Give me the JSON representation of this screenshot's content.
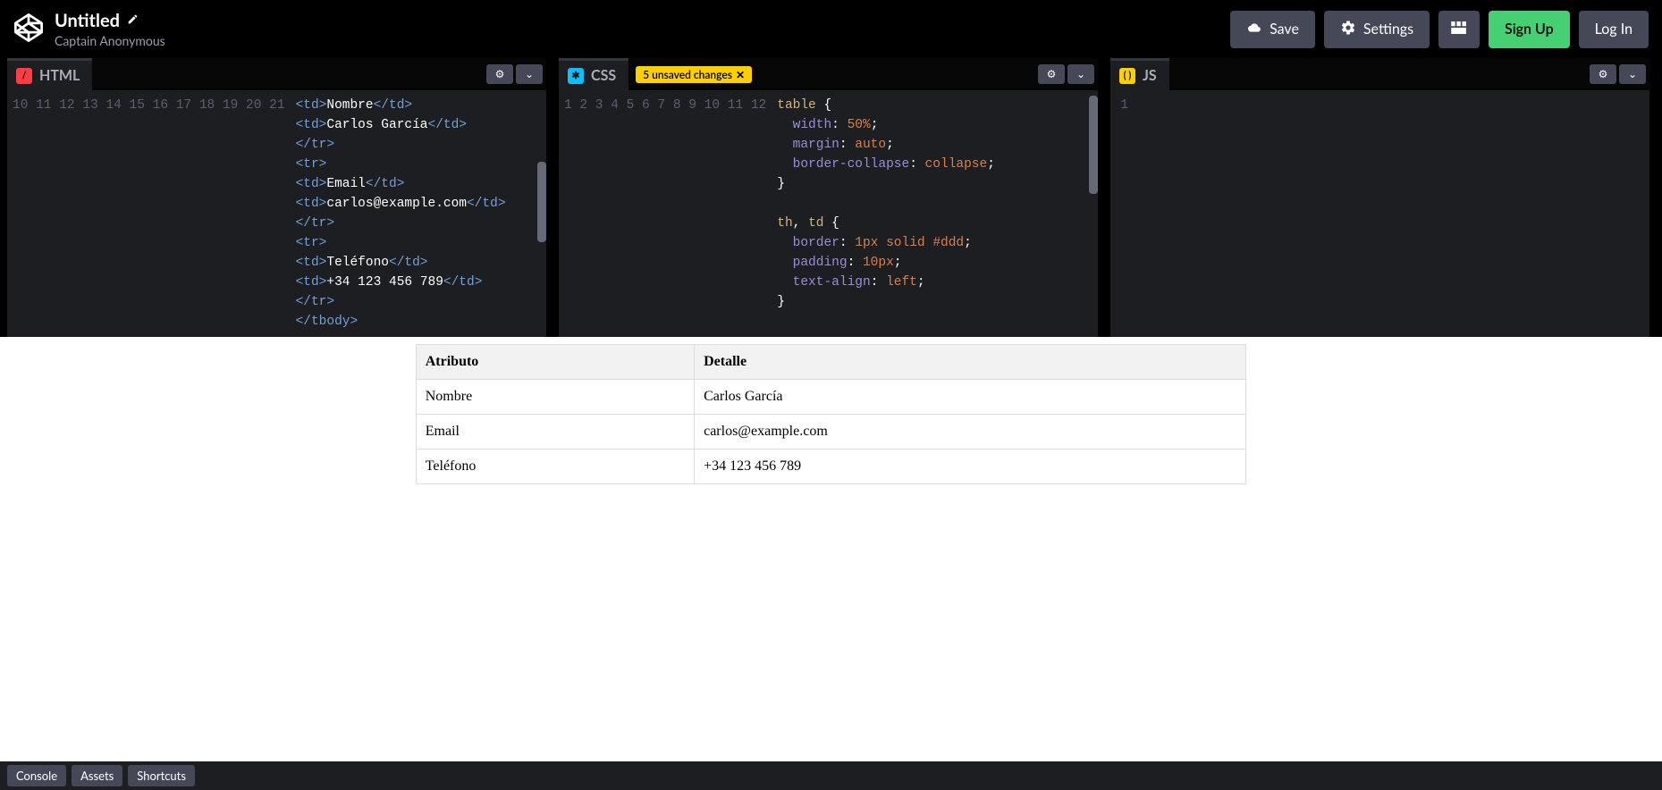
{
  "header": {
    "title": "Untitled",
    "author": "Captain Anonymous",
    "save_label": "Save",
    "settings_label": "Settings",
    "signup_label": "Sign Up",
    "login_label": "Log In"
  },
  "panes": {
    "html": {
      "label": "HTML",
      "gutter_start": 10,
      "lines": [
        [
          [
            "tag",
            "<td>"
          ],
          [
            "text",
            "Nombre"
          ],
          [
            "tag",
            "</td>"
          ]
        ],
        [
          [
            "tag",
            "<td>"
          ],
          [
            "text",
            "Carlos García"
          ],
          [
            "tag",
            "</td>"
          ]
        ],
        [
          [
            "tag",
            "</tr>"
          ]
        ],
        [
          [
            "tag",
            "<tr>"
          ]
        ],
        [
          [
            "tag",
            "<td>"
          ],
          [
            "text",
            "Email"
          ],
          [
            "tag",
            "</td>"
          ]
        ],
        [
          [
            "tag",
            "<td>"
          ],
          [
            "text",
            "carlos@example.com"
          ],
          [
            "tag",
            "</td>"
          ]
        ],
        [
          [
            "tag",
            "</tr>"
          ]
        ],
        [
          [
            "tag",
            "<tr>"
          ]
        ],
        [
          [
            "tag",
            "<td>"
          ],
          [
            "text",
            "Teléfono"
          ],
          [
            "tag",
            "</td>"
          ]
        ],
        [
          [
            "tag",
            "<td>"
          ],
          [
            "text",
            "+34 123 456 789"
          ],
          [
            "tag",
            "</td>"
          ]
        ],
        [
          [
            "tag",
            "</tr>"
          ]
        ],
        [
          [
            "tag",
            "</tbody>"
          ]
        ]
      ]
    },
    "css": {
      "label": "CSS",
      "unsaved_badge": "5 unsaved changes",
      "gutter_start": 1,
      "lines": [
        [
          [
            "sel",
            "table "
          ],
          [
            "text",
            "{"
          ]
        ],
        [
          [
            "text",
            "  "
          ],
          [
            "prop",
            "width"
          ],
          [
            "text",
            ": "
          ],
          [
            "val",
            "50%"
          ],
          [
            "text",
            ";"
          ]
        ],
        [
          [
            "text",
            "  "
          ],
          [
            "prop",
            "margin"
          ],
          [
            "text",
            ": "
          ],
          [
            "val",
            "auto"
          ],
          [
            "text",
            ";"
          ]
        ],
        [
          [
            "text",
            "  "
          ],
          [
            "prop",
            "border-collapse"
          ],
          [
            "text",
            ": "
          ],
          [
            "val",
            "collapse"
          ],
          [
            "text",
            ";"
          ]
        ],
        [
          [
            "text",
            "}"
          ]
        ],
        [
          [
            "text",
            ""
          ]
        ],
        [
          [
            "sel",
            "th"
          ],
          [
            "text",
            ", "
          ],
          [
            "sel",
            "td "
          ],
          [
            "text",
            "{"
          ]
        ],
        [
          [
            "text",
            "  "
          ],
          [
            "prop",
            "border"
          ],
          [
            "text",
            ": "
          ],
          [
            "val",
            "1px"
          ],
          [
            "text",
            " "
          ],
          [
            "val",
            "solid"
          ],
          [
            "text",
            " "
          ],
          [
            "val",
            "#ddd"
          ],
          [
            "text",
            ";"
          ]
        ],
        [
          [
            "text",
            "  "
          ],
          [
            "prop",
            "padding"
          ],
          [
            "text",
            ": "
          ],
          [
            "val",
            "10px"
          ],
          [
            "text",
            ";"
          ]
        ],
        [
          [
            "text",
            "  "
          ],
          [
            "prop",
            "text-align"
          ],
          [
            "text",
            ": "
          ],
          [
            "val",
            "left"
          ],
          [
            "text",
            ";"
          ]
        ],
        [
          [
            "text",
            "}"
          ]
        ],
        [
          [
            "text",
            ""
          ]
        ]
      ]
    },
    "js": {
      "label": "JS",
      "gutter_start": 1,
      "lines": [
        [
          [
            "text",
            ""
          ]
        ]
      ]
    }
  },
  "preview_table": {
    "headers": [
      "Atributo",
      "Detalle"
    ],
    "rows": [
      [
        "Nombre",
        "Carlos García"
      ],
      [
        "Email",
        "carlos@example.com"
      ],
      [
        "Teléfono",
        "+34 123 456 789"
      ]
    ]
  },
  "footer": {
    "console_label": "Console",
    "assets_label": "Assets",
    "shortcuts_label": "Shortcuts"
  }
}
